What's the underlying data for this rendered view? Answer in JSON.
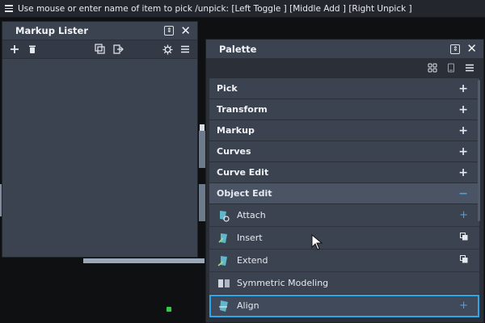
{
  "prompt": {
    "text": "Use mouse or enter name of item to pick /unpick: [Left Toggle ] [Middle Add ] [Right Unpick ]"
  },
  "markup_lister": {
    "title": "Markup Lister",
    "toolbar_icons": [
      "add-icon",
      "trash-icon",
      "copy-layers-icon",
      "export-icon",
      "gear-icon",
      "menu-icon"
    ]
  },
  "palette": {
    "title": "Palette",
    "toolbar_icons": [
      "grid-view-icon",
      "phone-view-icon",
      "menu-icon"
    ],
    "categories": [
      {
        "label": "Pick",
        "toggle": "+"
      },
      {
        "label": "Transform",
        "toggle": "+"
      },
      {
        "label": "Markup",
        "toggle": "+"
      },
      {
        "label": "Curves",
        "toggle": "+"
      },
      {
        "label": "Curve Edit",
        "toggle": "+"
      },
      {
        "label": "Object Edit",
        "toggle": "−"
      }
    ],
    "items": [
      {
        "label": "Attach",
        "icon": "attach-icon",
        "action": "+"
      },
      {
        "label": "Insert",
        "icon": "insert-icon",
        "action": "copy"
      },
      {
        "label": "Extend",
        "icon": "extend-icon",
        "action": "copy"
      },
      {
        "label": "Symmetric Modeling",
        "icon": "symmetric-modeling-icon",
        "action": ""
      },
      {
        "label": "Align",
        "icon": "align-icon",
        "action": "+"
      }
    ]
  },
  "colors": {
    "accent": "#3ea7e8",
    "panel": "#3b4250",
    "background": "#0f1012"
  }
}
